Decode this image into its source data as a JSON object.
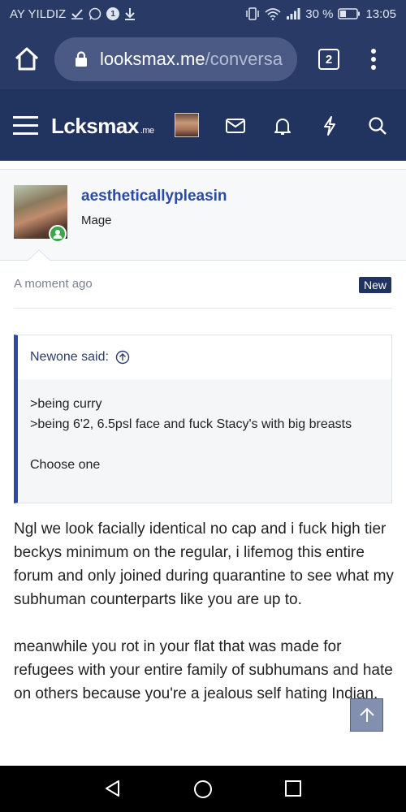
{
  "status_bar": {
    "carrier": "AY YILDIZ",
    "battery_text": "30 %",
    "time": "13:05",
    "notification_badge": "1"
  },
  "browser": {
    "url_host": "looksmax.me",
    "url_path": "/conversa",
    "tab_count": "2"
  },
  "site": {
    "logo_main": "Lcksmax",
    "logo_suffix": ".me"
  },
  "user": {
    "name": "aestheticallypleasin",
    "title": "Mage"
  },
  "post": {
    "time": "A moment ago",
    "badge": "New",
    "quote": {
      "author": "Newone said:",
      "lines": [
        ">being curry",
        ">being 6'2, 6.5psl face and fuck Stacy's with big breasts",
        "Choose one"
      ]
    },
    "body": [
      "Ngl we look facially identical no cap and i fuck high tier beckys minimum on the regular, i lifemog this entire forum and only joined during quarantine to see what my subhuman counterparts like you are up to.",
      "meanwhile you rot in your flat that was made for refugees with your entire family of subhumans and hate on others because you're a jealous self hating Indian."
    ]
  },
  "colors": {
    "browser_bg": "#2a3a67",
    "header_bg": "#21335f",
    "link": "#2b4aa3",
    "online": "#3aa84a"
  }
}
